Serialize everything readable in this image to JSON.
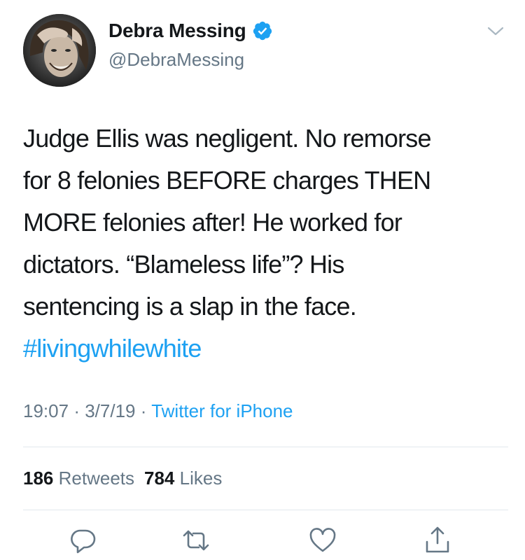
{
  "user": {
    "display_name": "Debra Messing",
    "handle": "@DebraMessing",
    "verified": true,
    "avatar_icon": "profile-photo"
  },
  "tweet": {
    "lines": [
      "Judge Ellis was negligent. No remorse",
      "for 8 felonies BEFORE charges THEN",
      "MORE felonies after! He worked for",
      "dictators. “Blameless life”? His",
      "sentencing is a slap in the face."
    ],
    "hashtag": "#livingwhilewhite"
  },
  "meta": {
    "time": "19:07",
    "date": "3/7/19",
    "source": "Twitter for iPhone",
    "separator": "·"
  },
  "stats": {
    "retweets_count": "186",
    "retweets_label": "Retweets",
    "likes_count": "784",
    "likes_label": "Likes"
  },
  "colors": {
    "link": "#1da1f2",
    "secondary": "#657786",
    "text": "#14171a",
    "divider": "#e1e8ed"
  },
  "actions": [
    "reply-icon",
    "retweet-icon",
    "like-icon",
    "share-icon"
  ]
}
